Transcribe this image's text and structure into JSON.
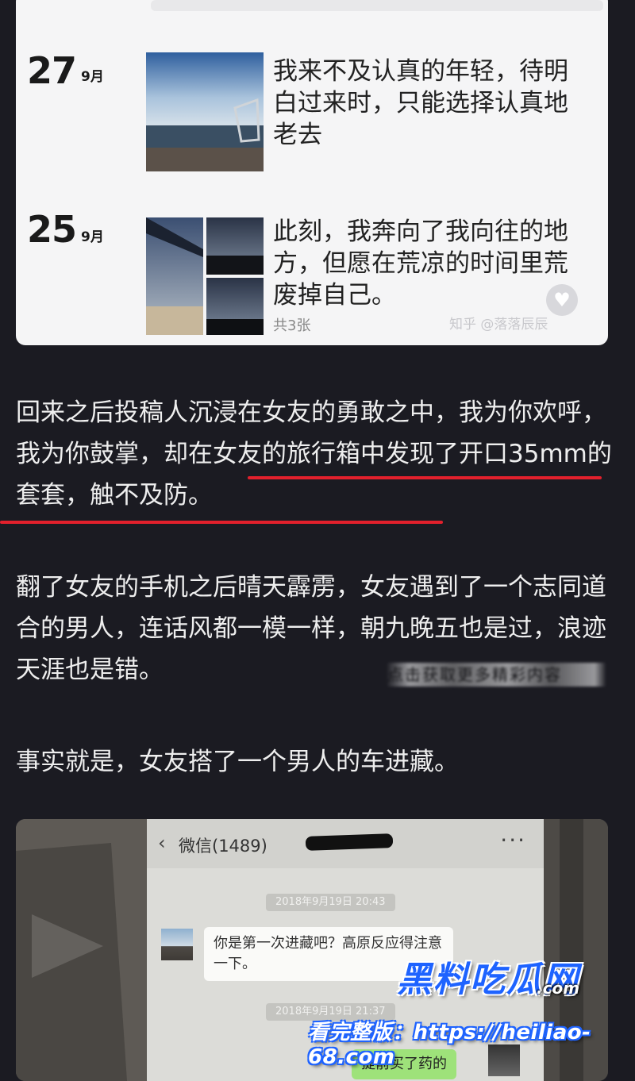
{
  "card": {
    "posts": [
      {
        "day": "27",
        "month": "9月",
        "text": "我来不及认真的年轻，待明白过来时，只能选择认真地老去"
      },
      {
        "day": "25",
        "month": "9月",
        "text": "此刻，我奔向了我向往的地方，但愿在荒凉的时间里荒废掉自己。",
        "count": "共3张"
      }
    ],
    "watermark": "知乎 @落落辰辰"
  },
  "article": {
    "p1_a": "回来之后投稿人沉浸在女友的勇敢之中，我为你欢呼，我为你鼓掌，",
    "p1_b": "却在女友的旅行箱中发现了开口35mm的套套，触不及防。",
    "p2": "翻了女友的手机之后晴天霹雳，女友遇到了一个志同道合的男人，连话风都一模一样，朝九晚五也是过，浪迹天涯也是错。",
    "p2_watermark": "点击获取更多精彩内容",
    "p3": "事实就是，女友搭了一个男人的车进藏。"
  },
  "chat": {
    "back_label": "微信(1489)",
    "time1": "2018年9月19日 20:43",
    "msg1": "你是第一次进藏吧？高原反应得注意一下。",
    "time2": "2018年9月19日 21:37",
    "msg2": "提前买了药的"
  },
  "watermark_site": {
    "logo": "黑料吃瓜网",
    "domain": ".com",
    "url_line": "看完整版：https://heiliao-68.com"
  },
  "colors": {
    "underline": "#e2202c",
    "page_bg": "#1b1b22",
    "text": "#eeeeee"
  }
}
